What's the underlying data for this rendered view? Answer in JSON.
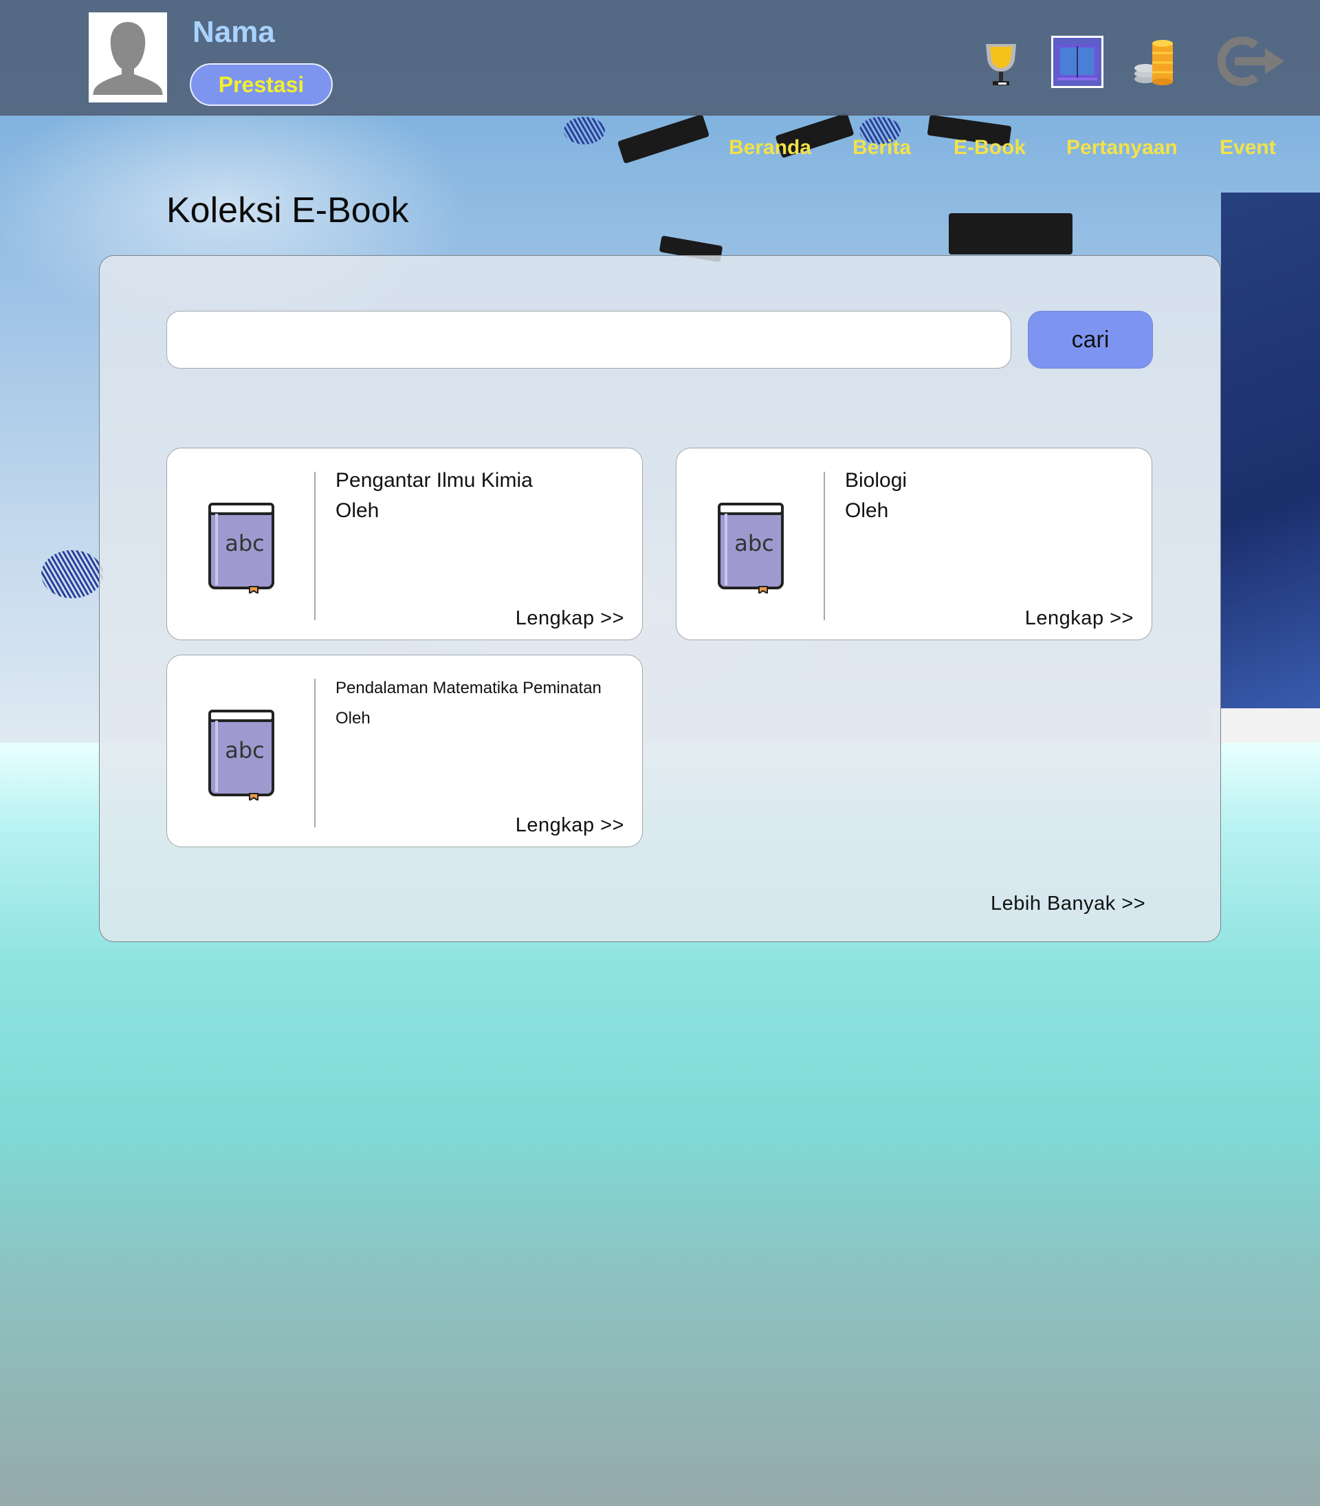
{
  "header": {
    "username": "Nama",
    "prestasi_label": "Prestasi"
  },
  "nav": {
    "items": [
      "Beranda",
      "Berita",
      "E-Book",
      "Pertanyaan",
      "Event"
    ]
  },
  "page": {
    "title": "Koleksi E-Book"
  },
  "search": {
    "value": "",
    "placeholder": "",
    "button_label": "cari"
  },
  "books": [
    {
      "title": "Pengantar Ilmu Kimia",
      "author_label": "Oleh",
      "link_label": "Lengkap >>",
      "cover_text": "abc"
    },
    {
      "title": "Biologi",
      "author_label": "Oleh",
      "link_label": "Lengkap >>",
      "cover_text": "abc"
    },
    {
      "title": "Pendalaman Matematika Peminatan",
      "author_label": "Oleh",
      "link_label": "Lengkap >>",
      "cover_text": "abc"
    }
  ],
  "more_label": "Lebih Banyak >>",
  "icons": {
    "avatar": "user-silhouette-icon",
    "achievements": "trophy-icon",
    "ebook": "open-book-icon",
    "points": "coins-icon",
    "logout": "logout-icon"
  },
  "colors": {
    "header_bg": "#506078",
    "username": "#a9d3ff",
    "button_bg": "#7e95ef",
    "button_text": "#f3ef2e",
    "nav_text": "#f2e24a",
    "book_cover": "#9e9ad0"
  }
}
